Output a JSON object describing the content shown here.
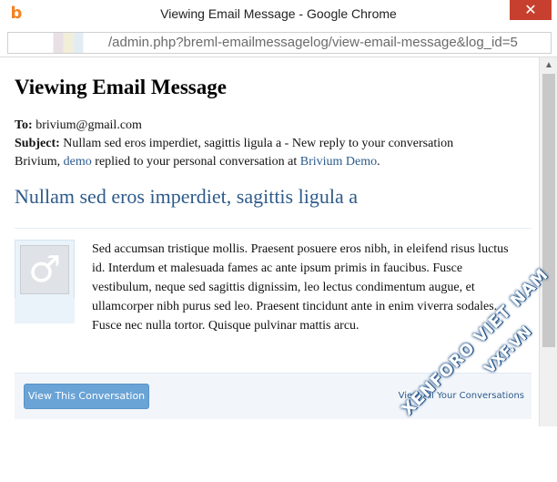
{
  "window": {
    "title": "Viewing Email Message - Google Chrome",
    "app_icon": "chrome-app-icon",
    "close_glyph": "✕"
  },
  "address_bar": {
    "url": "/admin.php?breml-emailmessagelog/view-email-message&log_id=5"
  },
  "page": {
    "title": "Viewing Email Message",
    "to_label": "To:",
    "to_value": "brivium@gmail.com",
    "subject_label": "Subject:",
    "subject_value": "Nullam sed eros imperdiet, sagittis ligula a - New reply to your conversation",
    "notice_prefix": "Brivium, ",
    "notice_user_link": "demo",
    "notice_middle": " replied to your personal conversation at ",
    "notice_site_link": "Brivium Demo",
    "notice_suffix": "."
  },
  "message": {
    "heading": "Nullam sed eros imperdiet, sagittis ligula a",
    "avatar_glyph": "♂",
    "body": "Sed accumsan tristique mollis. Praesent posuere eros nibh, in eleifend risus luctus id. Interdum et malesuada fames ac ante ipsum primis in faucibus. Fusce vestibulum, neque sed sagittis dignissim, leo lectus condimentum augue, et ullamcorper nibh purus sed leo. Praesent tincidunt ante in enim viverra sodales. Fusce nec nulla tortor. Quisque pulvinar mattis arcu."
  },
  "actions": {
    "view_button": "View This Conversation",
    "view_all": "View All Your Conversations"
  },
  "watermark": {
    "line1": "XENFORO VIET NAM",
    "line2": "VXF.VN"
  },
  "colors": {
    "link": "#2b5a8c",
    "heading": "#2e5b8a",
    "button": "#6aa3d6",
    "close": "#c7402f"
  }
}
